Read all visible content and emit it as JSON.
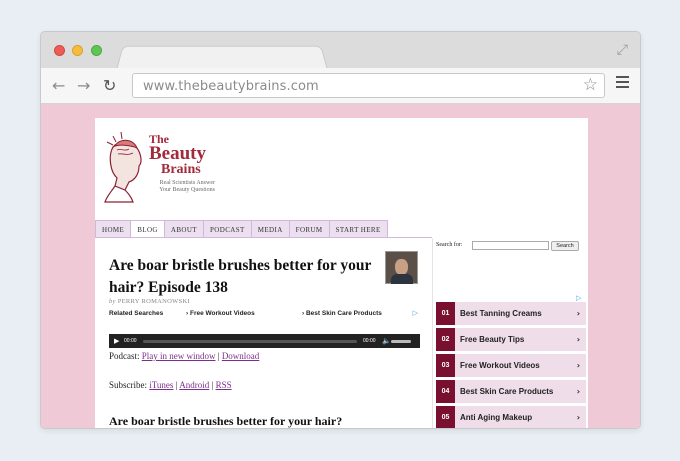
{
  "browser": {
    "url": "www.thebeautybrains.com"
  },
  "site": {
    "logo": {
      "the": "The",
      "beauty": "Beauty",
      "brains": "Brains",
      "tagline_1": "Real Scientists Answer",
      "tagline_2": "Your Beauty Questions"
    },
    "nav": [
      "HOME",
      "BLOG",
      "ABOUT",
      "PODCAST",
      "MEDIA",
      "FORUM",
      "START HERE"
    ]
  },
  "post": {
    "title": "Are boar bristle brushes better for your hair? Episode 138",
    "byline_prefix": "by",
    "author": "PERRY ROMANOWSKI",
    "related_label": "Related Searches",
    "related_1": "Free Workout Videos",
    "related_2": "Best Skin Care Products",
    "player": {
      "time_current": "00:00",
      "time_total": "00:00"
    },
    "podcast_label": "Podcast:",
    "podcast_play": "Play in new window",
    "podcast_sep": "|",
    "podcast_download": "Download",
    "subscribe_label": "Subscribe:",
    "sub_itunes": "iTunes",
    "sub_android": "Android",
    "sub_rss": "RSS",
    "subheading": "Are boar bristle brushes better for your hair?"
  },
  "sidebar": {
    "search_label": "Search for:",
    "search_button": "Search",
    "ads": [
      {
        "num": "01",
        "label": "Best Tanning Creams"
      },
      {
        "num": "02",
        "label": "Free Beauty Tips"
      },
      {
        "num": "03",
        "label": "Free Workout Videos"
      },
      {
        "num": "04",
        "label": "Best Skin Care Products"
      },
      {
        "num": "05",
        "label": "Anti Aging Makeup"
      }
    ]
  }
}
